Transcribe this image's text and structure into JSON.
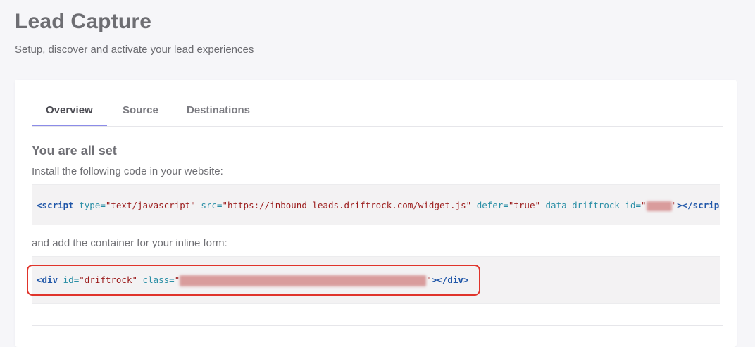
{
  "header": {
    "title": "Lead Capture",
    "subtitle": "Setup, discover and activate your lead experiences"
  },
  "tabs": [
    {
      "label": "Overview",
      "active": true
    },
    {
      "label": "Source",
      "active": false
    },
    {
      "label": "Destinations",
      "active": false
    }
  ],
  "content": {
    "heading": "You are all set",
    "install_instruction": "Install the following code in your website:",
    "container_instruction": "and add the container for your inline form:",
    "script_code": {
      "open": "<script",
      "type_attr": "type=",
      "type_val": "\"text/javascript\"",
      "src_attr": "src=",
      "src_val": "\"https://inbound-leads.driftrock.com/widget.js\"",
      "defer_attr": "defer=",
      "defer_val": "\"true\"",
      "id_attr": "data-driftrock-id=",
      "quote": "\"",
      "close": "></scrip"
    },
    "div_code": {
      "open": "<div",
      "id_attr": "id=",
      "id_val": "\"driftrock\"",
      "class_attr": "class=",
      "quote": "\"",
      "close": "></div>"
    }
  },
  "colors": {
    "accent": "#8c8ce8",
    "highlight": "#e0342b",
    "code_tag": "#1f56a8",
    "code_attr": "#2a8fa6",
    "code_value": "#9b1b1b"
  }
}
